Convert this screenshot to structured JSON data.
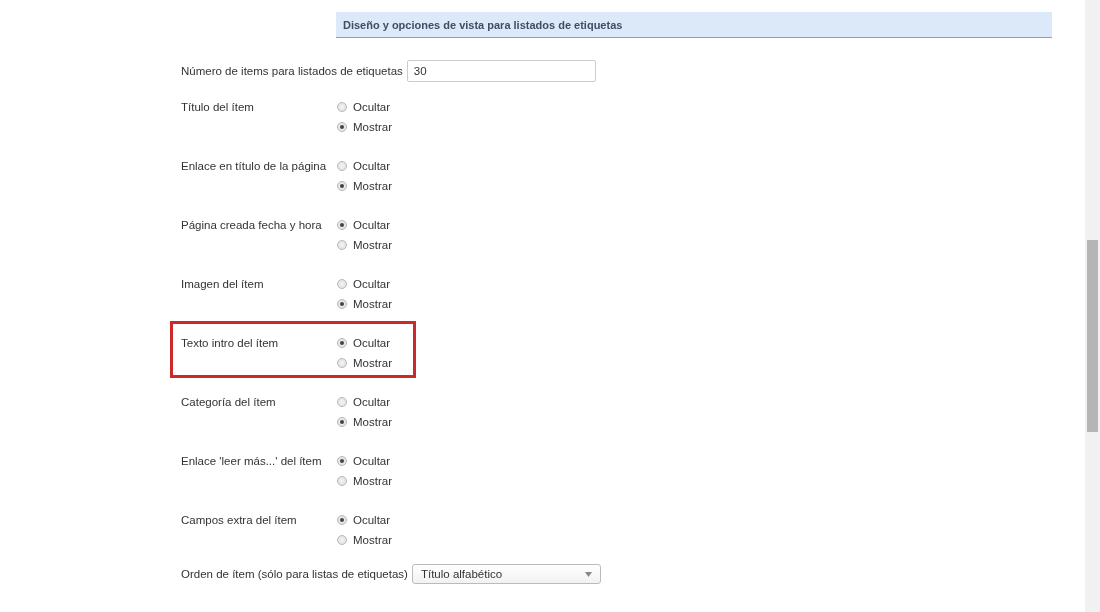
{
  "section_header": "Diseño y opciones de vista para listados de etiquetas",
  "items_count": {
    "label": "Número de items para listados de etiquetas",
    "value": "30"
  },
  "settings": [
    {
      "label": "Título del ítem",
      "highlighted": false,
      "options": [
        {
          "label": "Ocultar",
          "selected": false
        },
        {
          "label": "Mostrar",
          "selected": true
        }
      ]
    },
    {
      "label": "Enlace en título de la página",
      "highlighted": false,
      "options": [
        {
          "label": "Ocultar",
          "selected": false
        },
        {
          "label": "Mostrar",
          "selected": true
        }
      ]
    },
    {
      "label": "Página creada fecha y hora",
      "highlighted": false,
      "options": [
        {
          "label": "Ocultar",
          "selected": true
        },
        {
          "label": "Mostrar",
          "selected": false
        }
      ]
    },
    {
      "label": "Imagen del ítem",
      "highlighted": false,
      "options": [
        {
          "label": "Ocultar",
          "selected": false
        },
        {
          "label": "Mostrar",
          "selected": true
        }
      ]
    },
    {
      "label": "Texto intro del ítem",
      "highlighted": true,
      "options": [
        {
          "label": "Ocultar",
          "selected": true
        },
        {
          "label": "Mostrar",
          "selected": false
        }
      ]
    },
    {
      "label": "Categoría del ítem",
      "highlighted": false,
      "options": [
        {
          "label": "Ocultar",
          "selected": false
        },
        {
          "label": "Mostrar",
          "selected": true
        }
      ]
    },
    {
      "label": "Enlace 'leer más...' del ítem",
      "highlighted": false,
      "options": [
        {
          "label": "Ocultar",
          "selected": true
        },
        {
          "label": "Mostrar",
          "selected": false
        }
      ]
    },
    {
      "label": "Campos extra del ítem",
      "highlighted": false,
      "options": [
        {
          "label": "Ocultar",
          "selected": true
        },
        {
          "label": "Mostrar",
          "selected": false
        }
      ]
    }
  ],
  "item_order": {
    "label": "Orden de ítem (sólo para listas de etiquetas)",
    "value": "Título alfabético"
  }
}
